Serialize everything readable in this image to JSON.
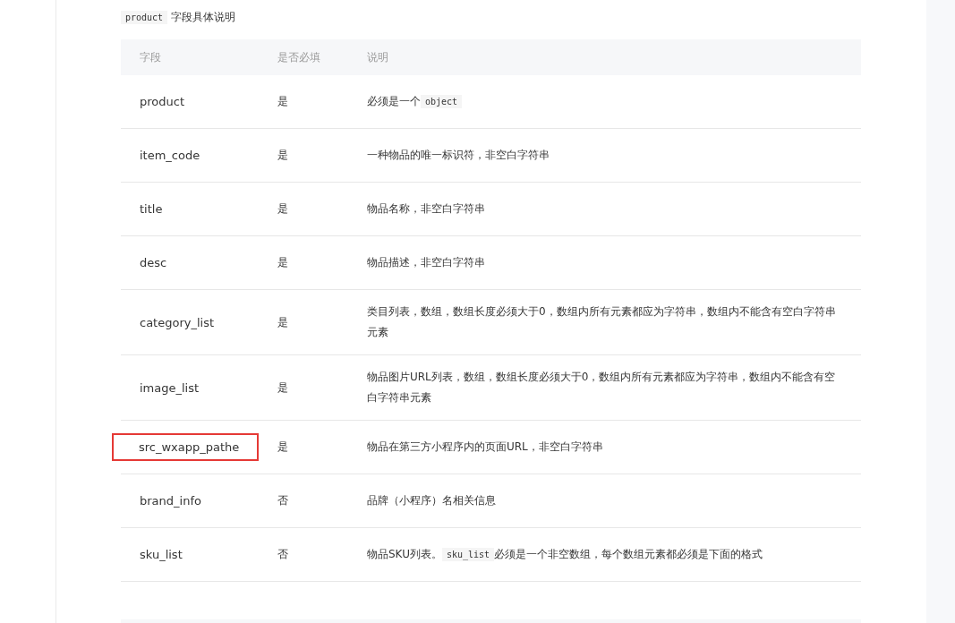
{
  "caption": [
    {
      "kind": "code",
      "text": "product"
    },
    {
      "kind": "text",
      "text": "字段具体说明"
    }
  ],
  "table": {
    "columns": [
      "字段",
      "是否必填",
      "说明"
    ],
    "rows": [
      {
        "field": "product",
        "required": "是",
        "highlighted": false,
        "desc": [
          {
            "kind": "text",
            "text": "必须是一个"
          },
          {
            "kind": "code",
            "text": "object"
          }
        ]
      },
      {
        "field": "item_code",
        "required": "是",
        "highlighted": false,
        "desc": [
          {
            "kind": "text",
            "text": "一种物品的唯一标识符，非空白字符串"
          }
        ]
      },
      {
        "field": "title",
        "required": "是",
        "highlighted": false,
        "desc": [
          {
            "kind": "text",
            "text": "物品名称，非空白字符串"
          }
        ]
      },
      {
        "field": "desc",
        "required": "是",
        "highlighted": false,
        "desc": [
          {
            "kind": "text",
            "text": "物品描述，非空白字符串"
          }
        ]
      },
      {
        "field": "category_list",
        "required": "是",
        "highlighted": false,
        "desc": [
          {
            "kind": "text",
            "text": "类目列表，数组，数组长度必须大于0，数组内所有元素都应为字符串，数组内不能含有空白字符串元素"
          }
        ]
      },
      {
        "field": "image_list",
        "required": "是",
        "highlighted": false,
        "desc": [
          {
            "kind": "text",
            "text": "物品图片URL列表，数组，数组长度必须大于0，数组内所有元素都应为字符串，数组内不能含有空白字符串元素"
          }
        ]
      },
      {
        "field": "src_wxapp_pathe",
        "required": "是",
        "highlighted": true,
        "desc": [
          {
            "kind": "text",
            "text": "物品在第三方小程序内的页面URL，非空白字符串"
          }
        ]
      },
      {
        "field": "brand_info",
        "required": "否",
        "highlighted": false,
        "desc": [
          {
            "kind": "text",
            "text": "品牌（小程序）名相关信息"
          }
        ]
      },
      {
        "field": "sku_list",
        "required": "否",
        "highlighted": false,
        "desc": [
          {
            "kind": "text",
            "text": "物品SKU列表。"
          },
          {
            "kind": "code",
            "text": "sku_list"
          },
          {
            "kind": "text",
            "text": "必须是一个非空数组，每个数组元素都必须是下面的格式"
          }
        ]
      }
    ]
  }
}
